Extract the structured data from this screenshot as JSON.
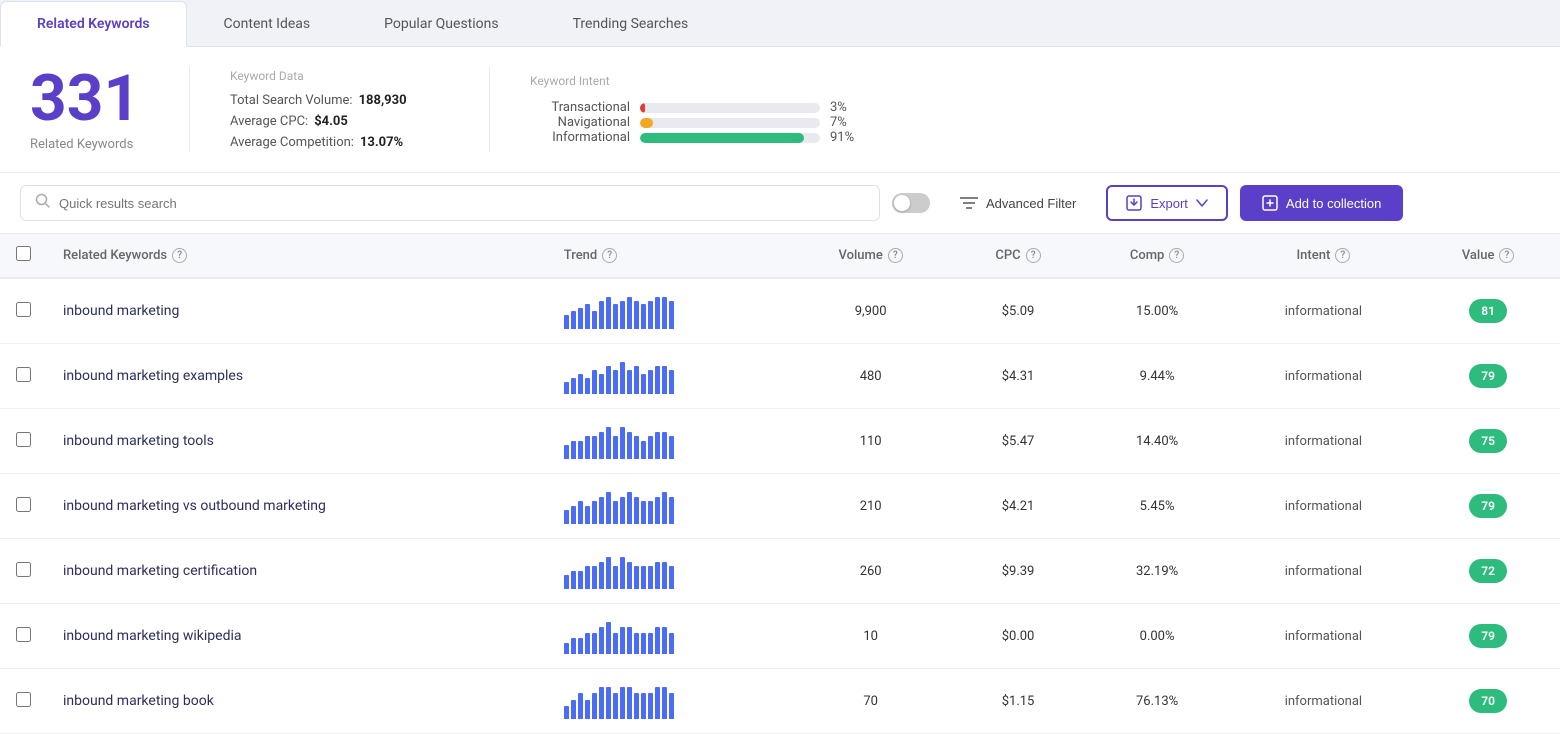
{
  "tabs": [
    {
      "id": "related-keywords",
      "label": "Related Keywords",
      "active": true
    },
    {
      "id": "content-ideas",
      "label": "Content Ideas",
      "active": false
    },
    {
      "id": "popular-questions",
      "label": "Popular Questions",
      "active": false
    },
    {
      "id": "trending-searches",
      "label": "Trending Searches",
      "active": false
    }
  ],
  "stats": {
    "count": "331",
    "count_label": "Related Keywords",
    "keyword_data_title": "Keyword Data",
    "total_search_volume_label": "Total Search Volume:",
    "total_search_volume_value": "188,930",
    "avg_cpc_label": "Average CPC:",
    "avg_cpc_value": "$4.05",
    "avg_competition_label": "Average Competition:",
    "avg_competition_value": "13.07%",
    "keyword_intent_title": "Keyword Intent",
    "intents": [
      {
        "label": "Transactional",
        "pct": 3,
        "color": "#e53935",
        "display": "3%"
      },
      {
        "label": "Navigational",
        "pct": 7,
        "color": "#f5a623",
        "display": "7%"
      },
      {
        "label": "Informational",
        "pct": 91,
        "color": "#2dbc7e",
        "display": "91%"
      }
    ]
  },
  "toolbar": {
    "search_placeholder": "Quick results search",
    "advanced_filter_label": "Advanced Filter",
    "export_label": "Export",
    "add_collection_label": "Add to collection"
  },
  "table": {
    "headers": [
      {
        "id": "checkbox",
        "label": ""
      },
      {
        "id": "keyword",
        "label": "Related Keywords"
      },
      {
        "id": "trend",
        "label": "Trend"
      },
      {
        "id": "volume",
        "label": "Volume"
      },
      {
        "id": "cpc",
        "label": "CPC"
      },
      {
        "id": "comp",
        "label": "Comp"
      },
      {
        "id": "intent",
        "label": "Intent"
      },
      {
        "id": "value",
        "label": "Value"
      }
    ],
    "rows": [
      {
        "keyword": "inbound marketing",
        "trend": [
          4,
          5,
          6,
          7,
          5,
          8,
          9,
          7,
          8,
          9,
          8,
          7,
          8,
          9,
          9,
          8
        ],
        "volume": "9,900",
        "cpc": "$5.09",
        "comp": "15.00%",
        "intent": "informational",
        "value": 81,
        "value_class": "good"
      },
      {
        "keyword": "inbound marketing examples",
        "trend": [
          3,
          4,
          5,
          4,
          6,
          5,
          7,
          6,
          8,
          6,
          7,
          5,
          6,
          7,
          7,
          6
        ],
        "volume": "480",
        "cpc": "$4.31",
        "comp": "9.44%",
        "intent": "informational",
        "value": 79,
        "value_class": "good"
      },
      {
        "keyword": "inbound marketing tools",
        "trend": [
          3,
          4,
          4,
          5,
          5,
          6,
          7,
          5,
          7,
          6,
          5,
          4,
          5,
          6,
          6,
          5
        ],
        "volume": "110",
        "cpc": "$5.47",
        "comp": "14.40%",
        "intent": "informational",
        "value": 75,
        "value_class": "good"
      },
      {
        "keyword": "inbound marketing vs outbound marketing",
        "trend": [
          3,
          4,
          5,
          4,
          5,
          6,
          7,
          5,
          6,
          7,
          6,
          5,
          5,
          6,
          7,
          6
        ],
        "volume": "210",
        "cpc": "$4.21",
        "comp": "5.45%",
        "intent": "informational",
        "value": 79,
        "value_class": "good"
      },
      {
        "keyword": "inbound marketing certification",
        "trend": [
          3,
          4,
          4,
          5,
          5,
          6,
          7,
          5,
          7,
          6,
          5,
          5,
          5,
          6,
          6,
          5
        ],
        "volume": "260",
        "cpc": "$9.39",
        "comp": "32.19%",
        "intent": "informational",
        "value": 72,
        "value_class": "good"
      },
      {
        "keyword": "inbound marketing wikipedia",
        "trend": [
          2,
          3,
          3,
          4,
          4,
          5,
          6,
          4,
          5,
          5,
          4,
          4,
          4,
          5,
          5,
          4
        ],
        "volume": "10",
        "cpc": "$0.00",
        "comp": "0.00%",
        "intent": "informational",
        "value": 79,
        "value_class": "good"
      },
      {
        "keyword": "inbound marketing book",
        "trend": [
          2,
          3,
          4,
          3,
          4,
          5,
          5,
          4,
          5,
          5,
          4,
          4,
          4,
          5,
          5,
          4
        ],
        "volume": "70",
        "cpc": "$1.15",
        "comp": "76.13%",
        "intent": "informational",
        "value": 70,
        "value_class": "good"
      }
    ]
  }
}
